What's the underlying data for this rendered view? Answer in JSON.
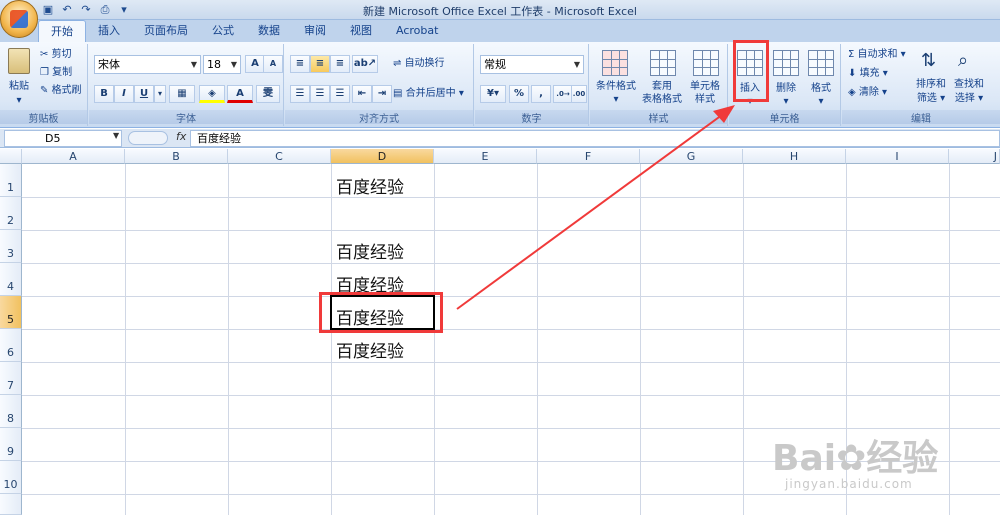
{
  "window": {
    "title": "新建 Microsoft Office Excel 工作表 - Microsoft Excel"
  },
  "tabs": [
    "开始",
    "插入",
    "页面布局",
    "公式",
    "数据",
    "审阅",
    "视图",
    "Acrobat"
  ],
  "ribbon": {
    "clipboard": {
      "paste": "粘贴",
      "cut": "剪切",
      "copy": "复制",
      "format_painter": "格式刷",
      "label": "剪贴板"
    },
    "font": {
      "name": "宋体",
      "size": "18",
      "label": "字体",
      "bold": "B",
      "italic": "I",
      "underline": "U",
      "grow": "A",
      "shrink": "A",
      "phonetic": "雯"
    },
    "alignment": {
      "wrap": "自动换行",
      "merge": "合并后居中",
      "label": "对齐方式"
    },
    "number": {
      "format": "常规",
      "percent": "%",
      "comma": ",",
      "label": "数字"
    },
    "styles": {
      "conditional": "条件格式",
      "table_1": "套用",
      "table_2": "表格格式",
      "cell_1": "单元格",
      "cell_2": "样式",
      "label": "样式"
    },
    "cells": {
      "insert": "插入",
      "delete": "删除",
      "format": "格式",
      "label": "单元格"
    },
    "editing": {
      "autosum": "自动求和",
      "fill": "填充",
      "clear": "清除",
      "sort_1": "排序和",
      "sort_2": "筛选",
      "find_1": "查找和",
      "find_2": "选择",
      "label": "编辑"
    }
  },
  "formula_bar": {
    "name_box": "D5",
    "fx": "fx",
    "content": "百度经验"
  },
  "columns": [
    "A",
    "B",
    "C",
    "D",
    "E",
    "F",
    "G",
    "H",
    "I",
    "J"
  ],
  "rows": [
    "1",
    "2",
    "3",
    "4",
    "5",
    "6",
    "7",
    "8",
    "9",
    "10"
  ],
  "cells": {
    "D1": "百度经验",
    "D3": "百度经验",
    "D4": "百度经验",
    "D5": "百度经验",
    "D6": "百度经验"
  },
  "active_cell": "D5",
  "watermark": {
    "brand": "Bai",
    "brand_suffix": "经验",
    "url": "jingyan.baidu.com"
  },
  "annotation_color": "#f03a3a"
}
